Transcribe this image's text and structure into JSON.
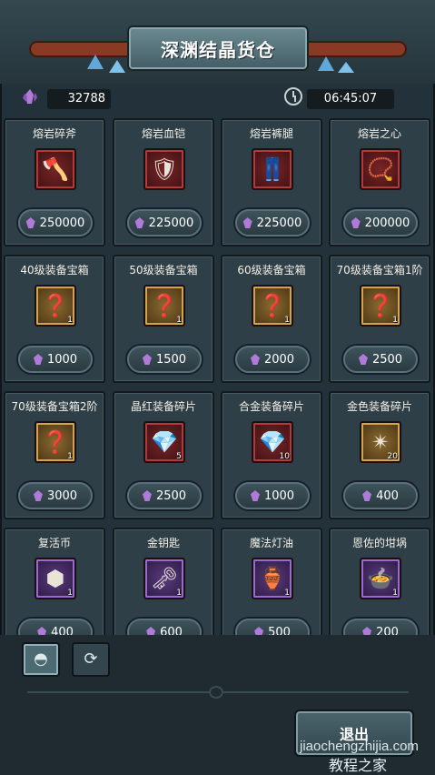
{
  "header": {
    "title": "深渊结晶货仓"
  },
  "status": {
    "crystal_count": "32788",
    "timer": "06:45:07"
  },
  "items": [
    {
      "name": "熔岩碎斧",
      "glyph": "🪓",
      "qty": "",
      "price": "250000",
      "rarity": "red"
    },
    {
      "name": "熔岩血铠",
      "glyph": "🛡",
      "qty": "",
      "price": "225000",
      "rarity": "red"
    },
    {
      "name": "熔岩裤腿",
      "glyph": "👖",
      "qty": "",
      "price": "225000",
      "rarity": "red"
    },
    {
      "name": "熔岩之心",
      "glyph": "📿",
      "qty": "",
      "price": "200000",
      "rarity": "red"
    },
    {
      "name": "40级装备宝箱",
      "glyph": "❓",
      "qty": "1",
      "price": "1000",
      "rarity": "gold"
    },
    {
      "name": "50级装备宝箱",
      "glyph": "❓",
      "qty": "1",
      "price": "1500",
      "rarity": "gold"
    },
    {
      "name": "60级装备宝箱",
      "glyph": "❓",
      "qty": "1",
      "price": "2000",
      "rarity": "gold"
    },
    {
      "name": "70级装备宝箱1阶",
      "glyph": "❓",
      "qty": "1",
      "price": "2500",
      "rarity": "gold"
    },
    {
      "name": "70级装备宝箱2阶",
      "glyph": "❓",
      "qty": "1",
      "price": "3000",
      "rarity": "gold"
    },
    {
      "name": "晶红装备碎片",
      "glyph": "💎",
      "qty": "5",
      "price": "2500",
      "rarity": "red"
    },
    {
      "name": "合金装备碎片",
      "glyph": "💎",
      "qty": "10",
      "price": "1000",
      "rarity": "red"
    },
    {
      "name": "金色装备碎片",
      "glyph": "✴",
      "qty": "20",
      "price": "400",
      "rarity": "gold"
    },
    {
      "name": "复活币",
      "glyph": "⬢",
      "qty": "1",
      "price": "400",
      "rarity": "purple"
    },
    {
      "name": "金钥匙",
      "glyph": "🗝",
      "qty": "1",
      "price": "600",
      "rarity": "purple"
    },
    {
      "name": "魔法灯油",
      "glyph": "🏺",
      "qty": "1",
      "price": "500",
      "rarity": "purple"
    },
    {
      "name": "恩佐的坩埚",
      "glyph": "🍲",
      "qty": "1",
      "price": "200",
      "rarity": "purple"
    }
  ],
  "tabs": [
    {
      "name": "shop-tab",
      "glyph": "◓"
    },
    {
      "name": "cycle-tab",
      "glyph": "⟳"
    }
  ],
  "footer": {
    "exit_label": "退出",
    "watermark_url": "jiaochengzhijia.com",
    "watermark_text": "教程之家"
  },
  "colors": {
    "crystal": "#b07ad8",
    "panel": "#2e3f47",
    "background": "#23323a"
  }
}
